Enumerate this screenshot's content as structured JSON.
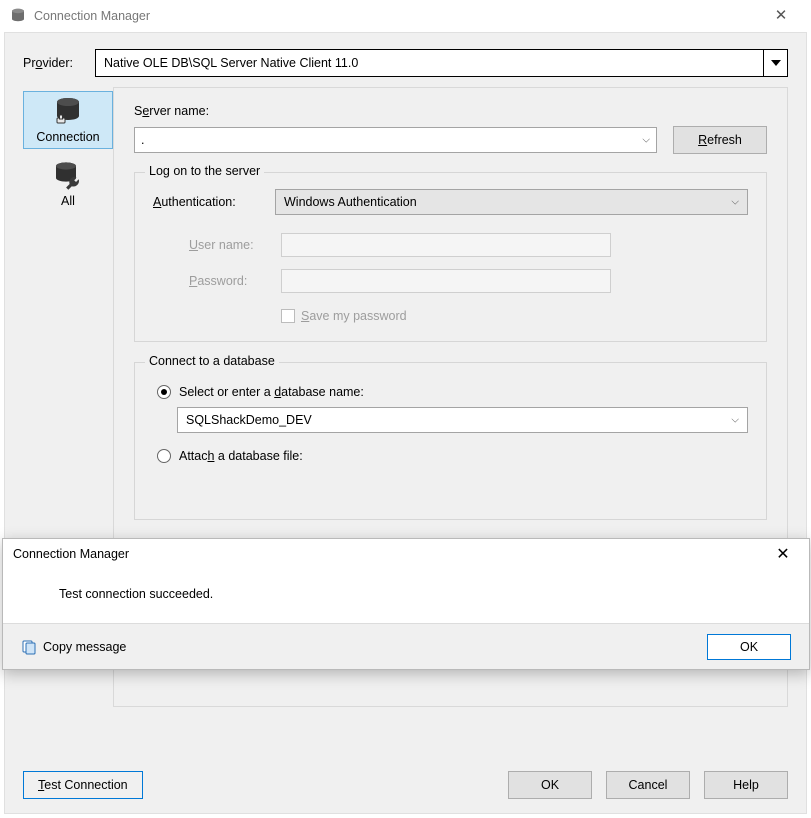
{
  "window": {
    "title": "Connection Manager"
  },
  "provider": {
    "label": "Provider:",
    "value": "Native OLE DB\\SQL Server Native Client 11.0"
  },
  "tabs": {
    "connection": "Connection",
    "all": "All"
  },
  "server": {
    "label": "Server name:",
    "value": ".",
    "refresh": "Refresh"
  },
  "logon": {
    "legend": "Log on to the server",
    "auth_label": "Authentication:",
    "auth_value": "Windows Authentication",
    "user_label": "User name:",
    "user_value": "",
    "pass_label": "Password:",
    "pass_value": "",
    "save_label": "Save my password"
  },
  "db": {
    "legend": "Connect to a database",
    "select_label": "Select or enter a database name:",
    "select_value": "SQLShackDemo_DEV",
    "attach_label": "Attach a database file:"
  },
  "buttons": {
    "test": "Test Connection",
    "ok": "OK",
    "cancel": "Cancel",
    "help": "Help"
  },
  "msg": {
    "title": "Connection Manager",
    "body": "Test connection succeeded.",
    "copy": "Copy message",
    "ok": "OK"
  }
}
